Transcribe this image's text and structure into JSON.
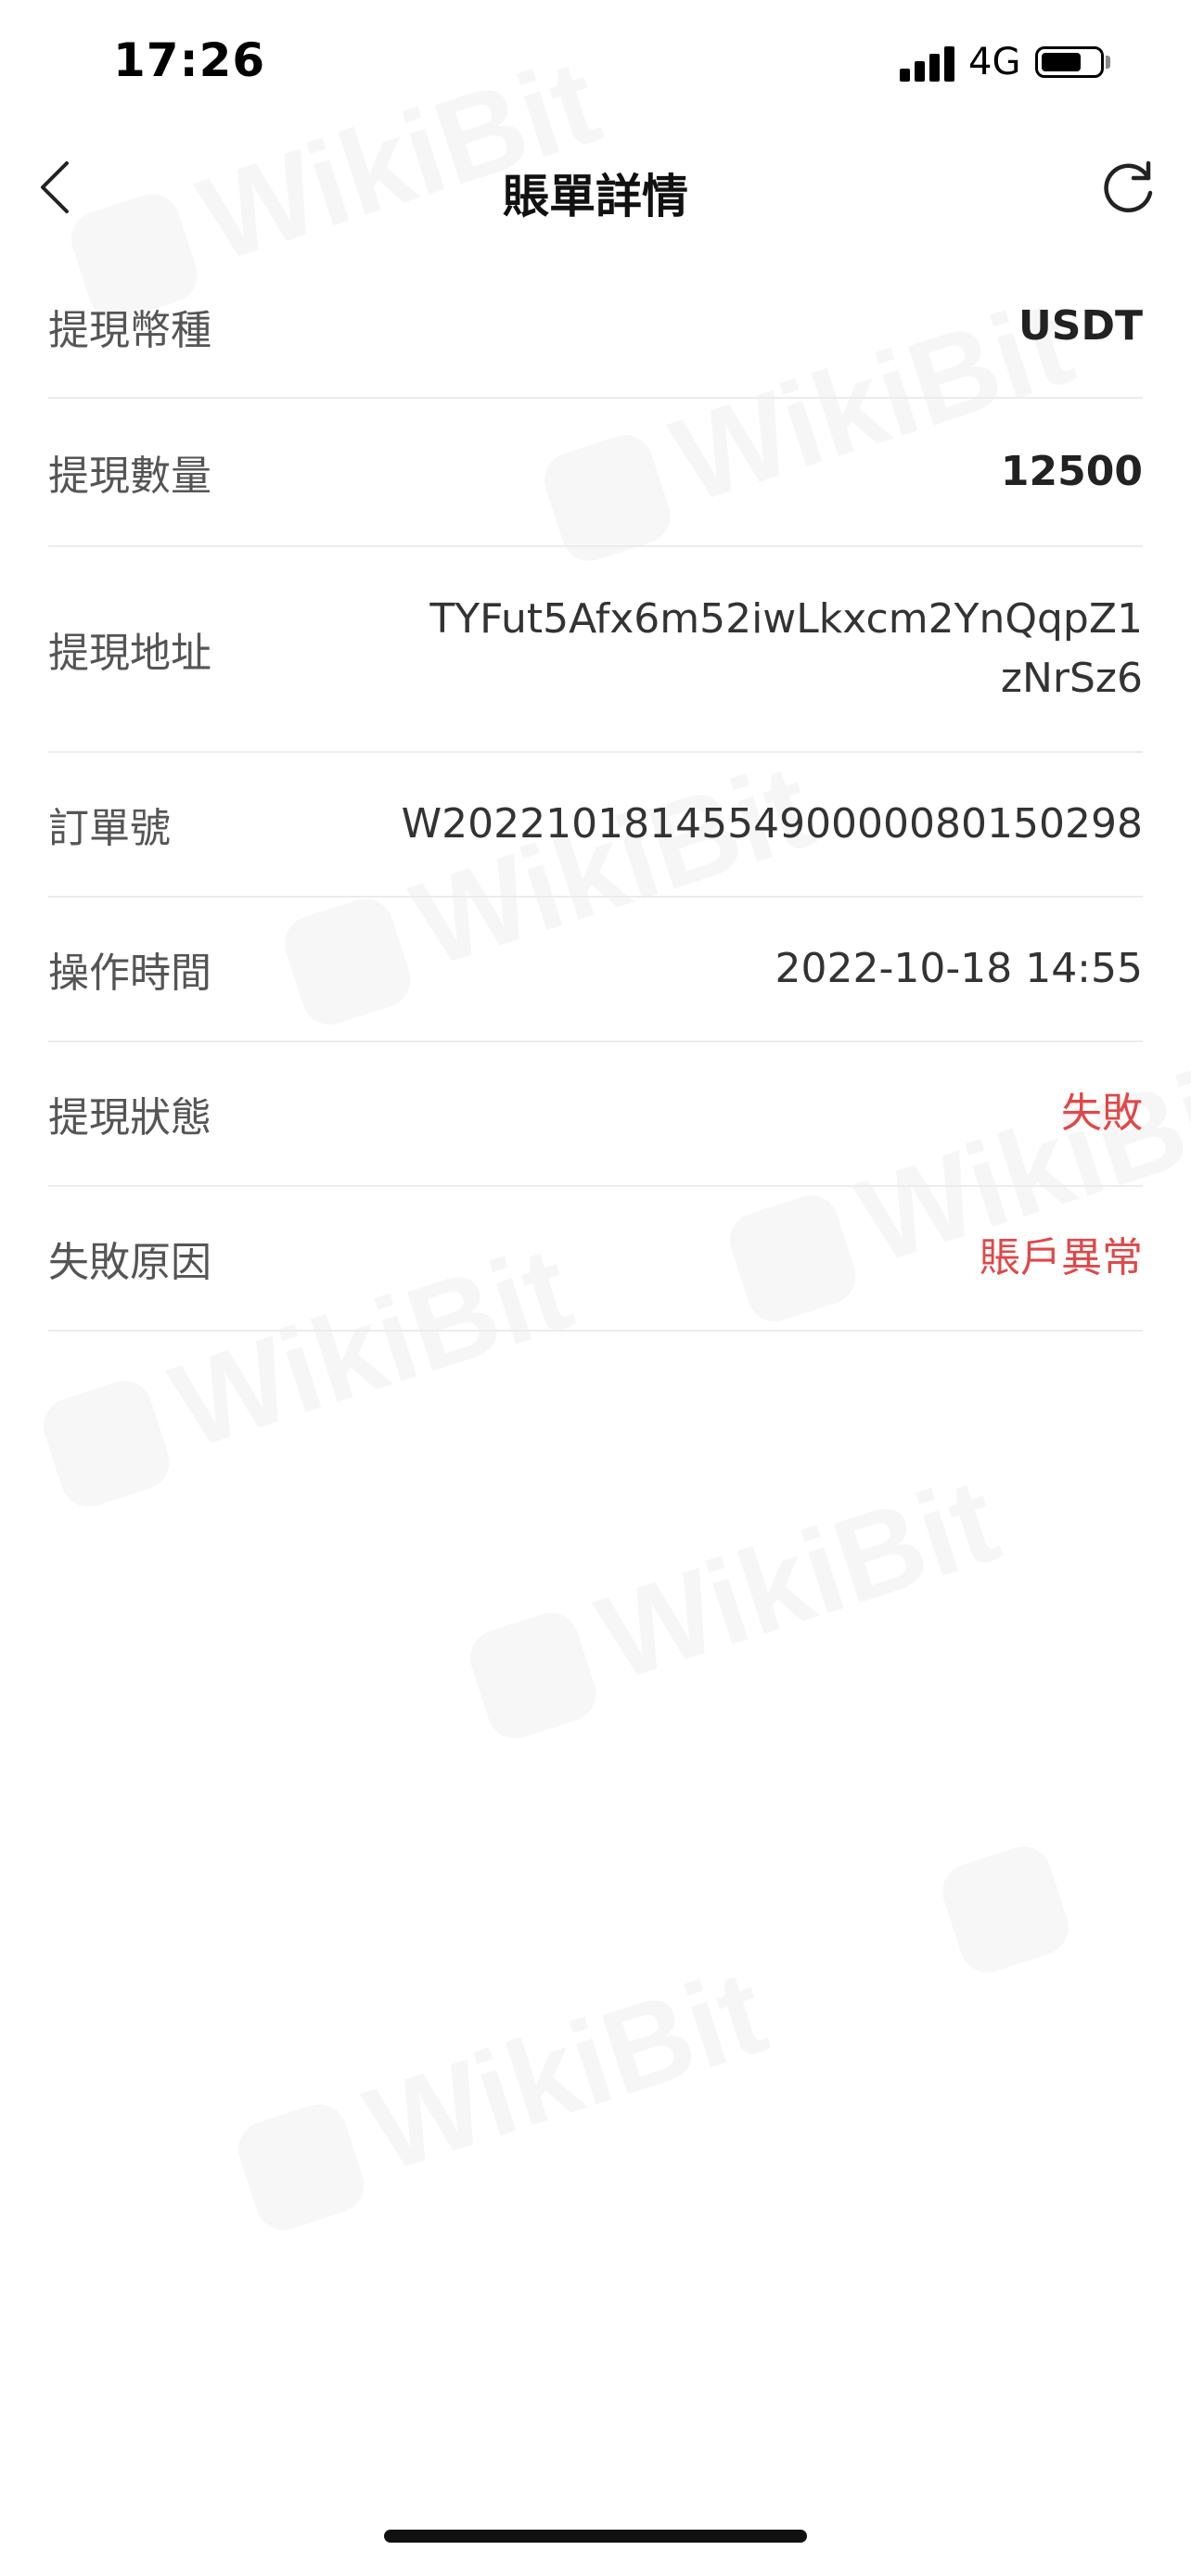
{
  "status_bar": {
    "time": "17:26",
    "network": "4G",
    "battery_level": 0.7
  },
  "nav": {
    "title": "賬單詳情",
    "back_icon": "chevron-left-icon",
    "refresh_icon": "refresh-icon"
  },
  "details": {
    "currency_label": "提現幣種",
    "currency_value": "USDT",
    "amount_label": "提現數量",
    "amount_value": "12500",
    "address_label": "提現地址",
    "address_value": "TYFut5Afx6m52iwLkxcm2YnQqpZ1zNrSz6",
    "order_label": "訂單號",
    "order_value": "W202210181455490000080150298",
    "time_label": "操作時間",
    "time_value": "2022-10-18 14:55",
    "status_label": "提現狀態",
    "status_value": "失敗",
    "reason_label": "失敗原因",
    "reason_value": "賬戶異常"
  },
  "watermark_text": "WikiBit",
  "colors": {
    "error": "#e04848",
    "divider": "#ececec"
  }
}
